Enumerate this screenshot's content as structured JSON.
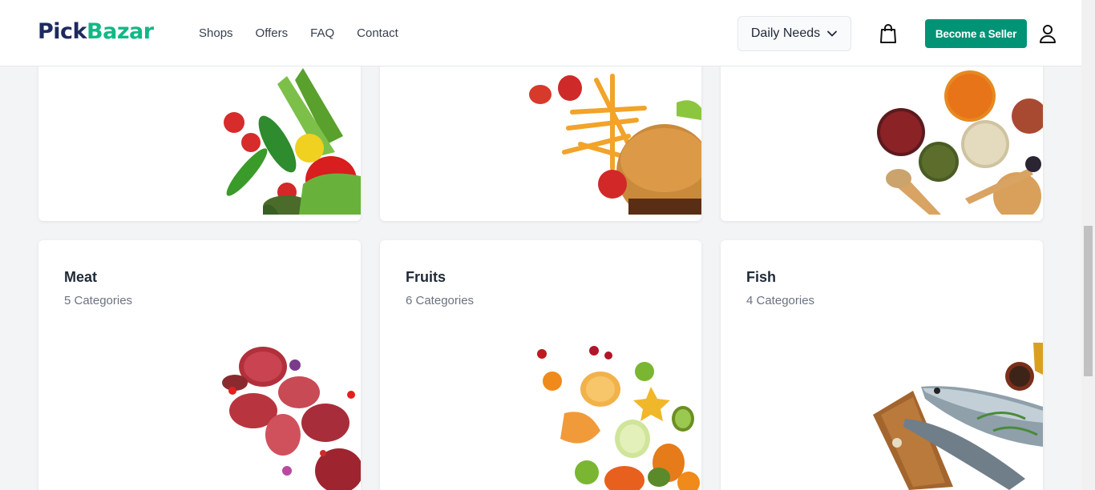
{
  "header": {
    "logo_part1": "Pick",
    "logo_part2": "Bazar",
    "nav": [
      "Shops",
      "Offers",
      "FAQ",
      "Contact"
    ],
    "shop_select": "Daily Needs",
    "seller_button": "Become a Seller"
  },
  "categories": [
    {
      "title": "Meat",
      "count": "5 Categories"
    },
    {
      "title": "Fruits",
      "count": "6 Categories"
    },
    {
      "title": "Fish",
      "count": "4 Categories"
    }
  ],
  "colors": {
    "brand_dark": "#1e2a5e",
    "brand_green": "#11b886",
    "button_green": "#019376"
  },
  "icons": [
    "chevron-down-icon",
    "shopping-bag-icon",
    "user-icon"
  ]
}
